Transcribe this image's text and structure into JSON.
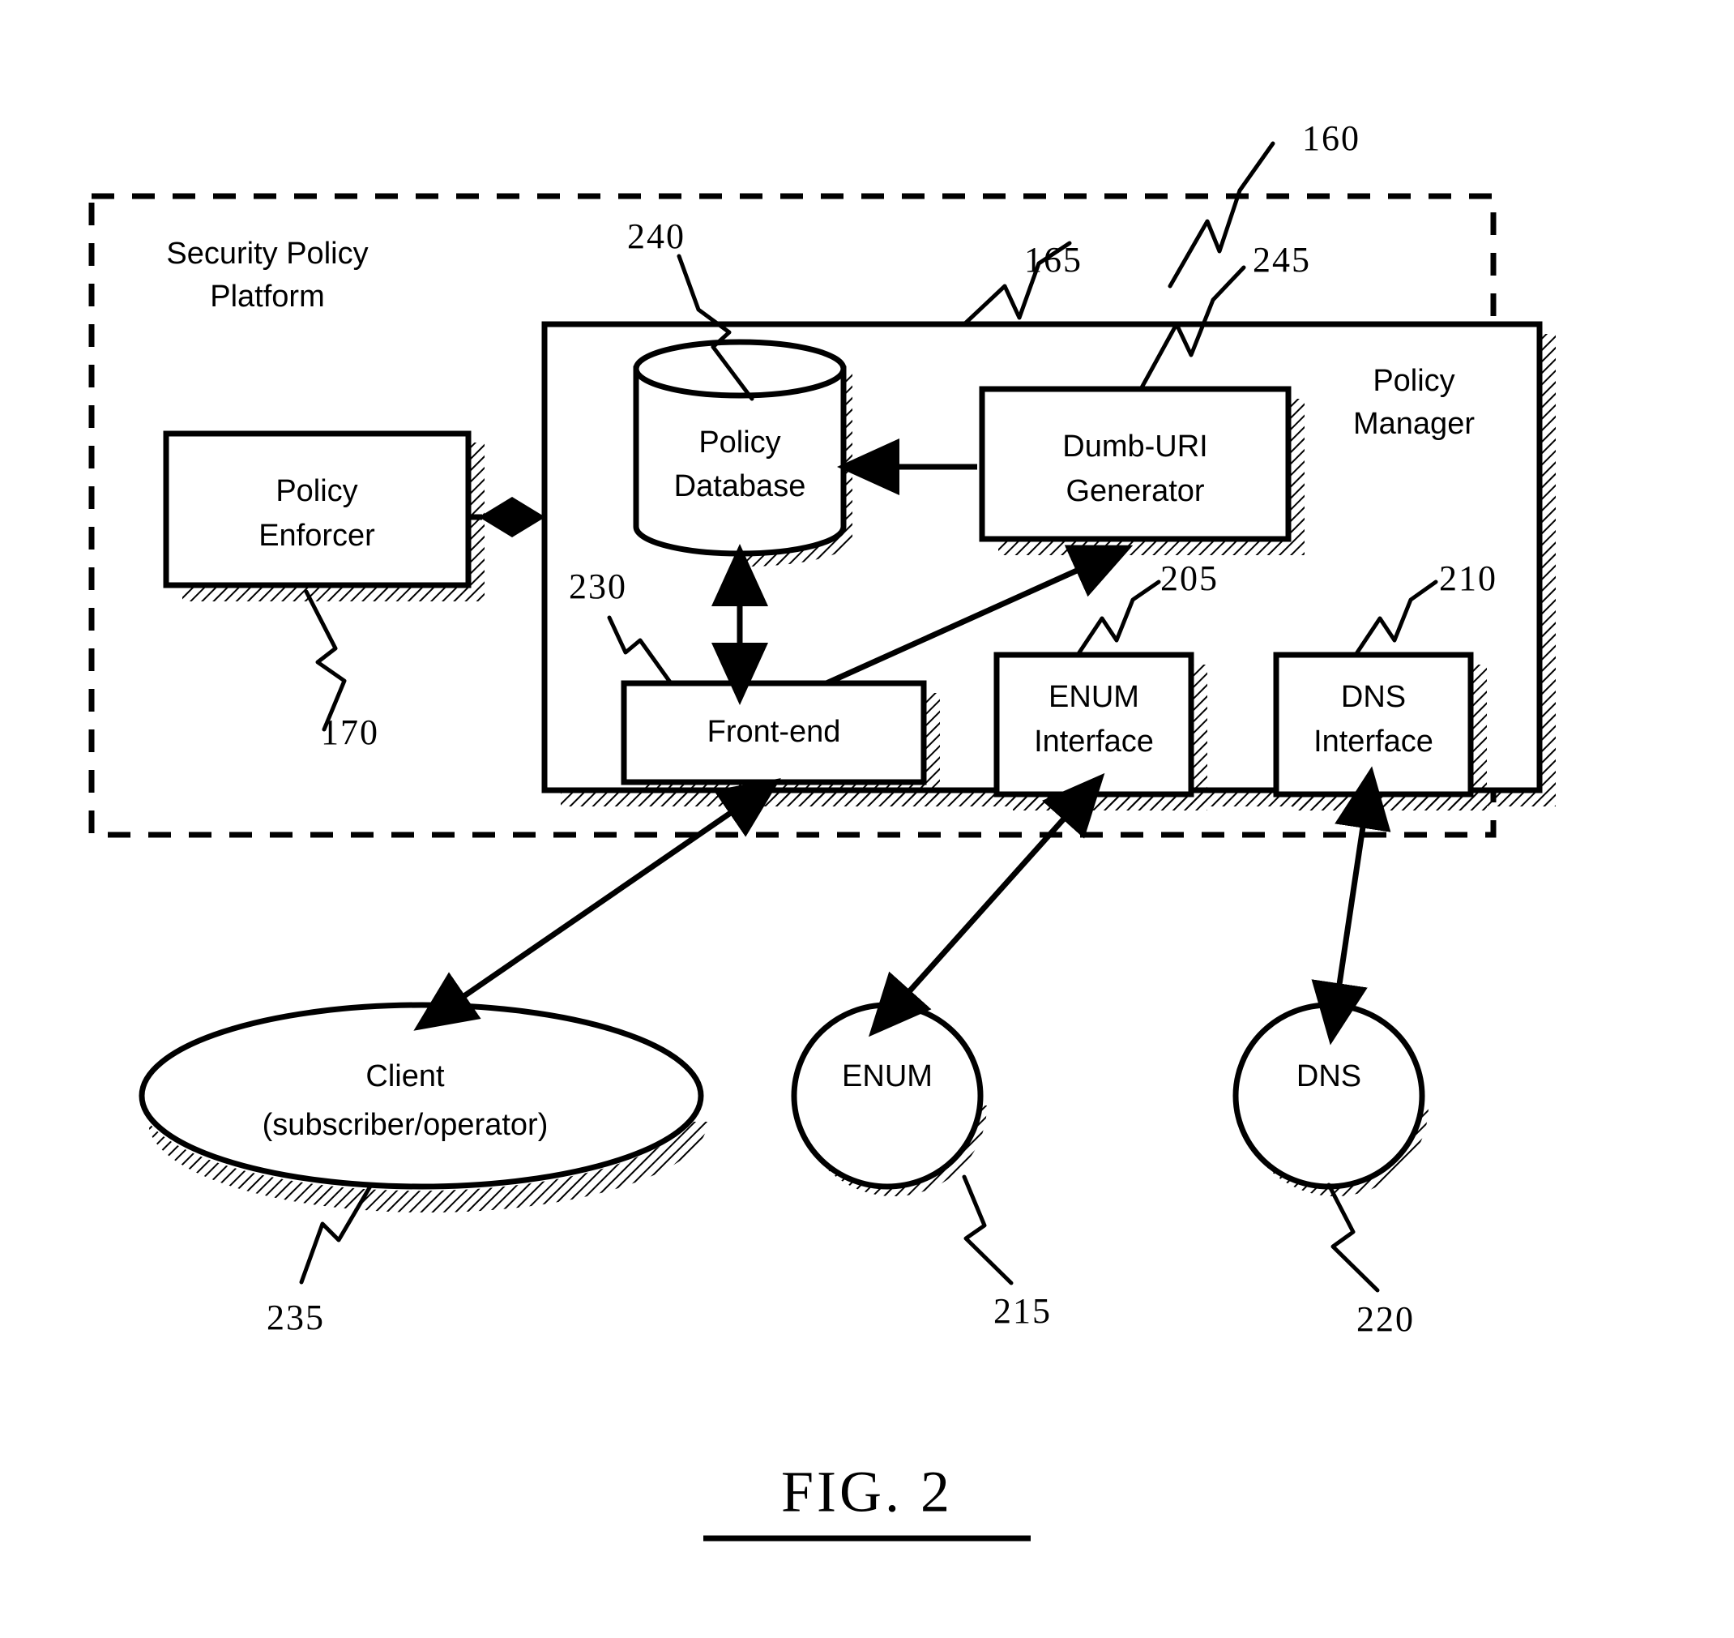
{
  "figure": {
    "caption": "FIG. 2"
  },
  "platform": {
    "label_line1": "Security Policy",
    "label_line2": "Platform",
    "ref": "160"
  },
  "policy_manager": {
    "label_line1": "Policy",
    "label_line2": "Manager",
    "ref": "165"
  },
  "nodes": {
    "policy_enforcer": {
      "label_line1": "Policy",
      "label_line2": "Enforcer",
      "ref": "170"
    },
    "policy_database": {
      "label_line1": "Policy",
      "label_line2": "Database",
      "ref": "240"
    },
    "dumb_uri_generator": {
      "label_line1": "Dumb-URI",
      "label_line2": "Generator",
      "ref": "245"
    },
    "front_end": {
      "label": "Front-end",
      "ref": "230"
    },
    "enum_interface": {
      "label_line1": "ENUM",
      "label_line2": "Interface",
      "ref": "205"
    },
    "dns_interface": {
      "label_line1": "DNS",
      "label_line2": "Interface",
      "ref": "210"
    },
    "client": {
      "label_line1": "Client",
      "label_line2": "(subscriber/operator)",
      "ref": "235"
    },
    "enum": {
      "label": "ENUM",
      "ref": "215"
    },
    "dns": {
      "label": "DNS",
      "ref": "220"
    }
  },
  "colors": {
    "line": "#000000",
    "background": "#ffffff"
  }
}
